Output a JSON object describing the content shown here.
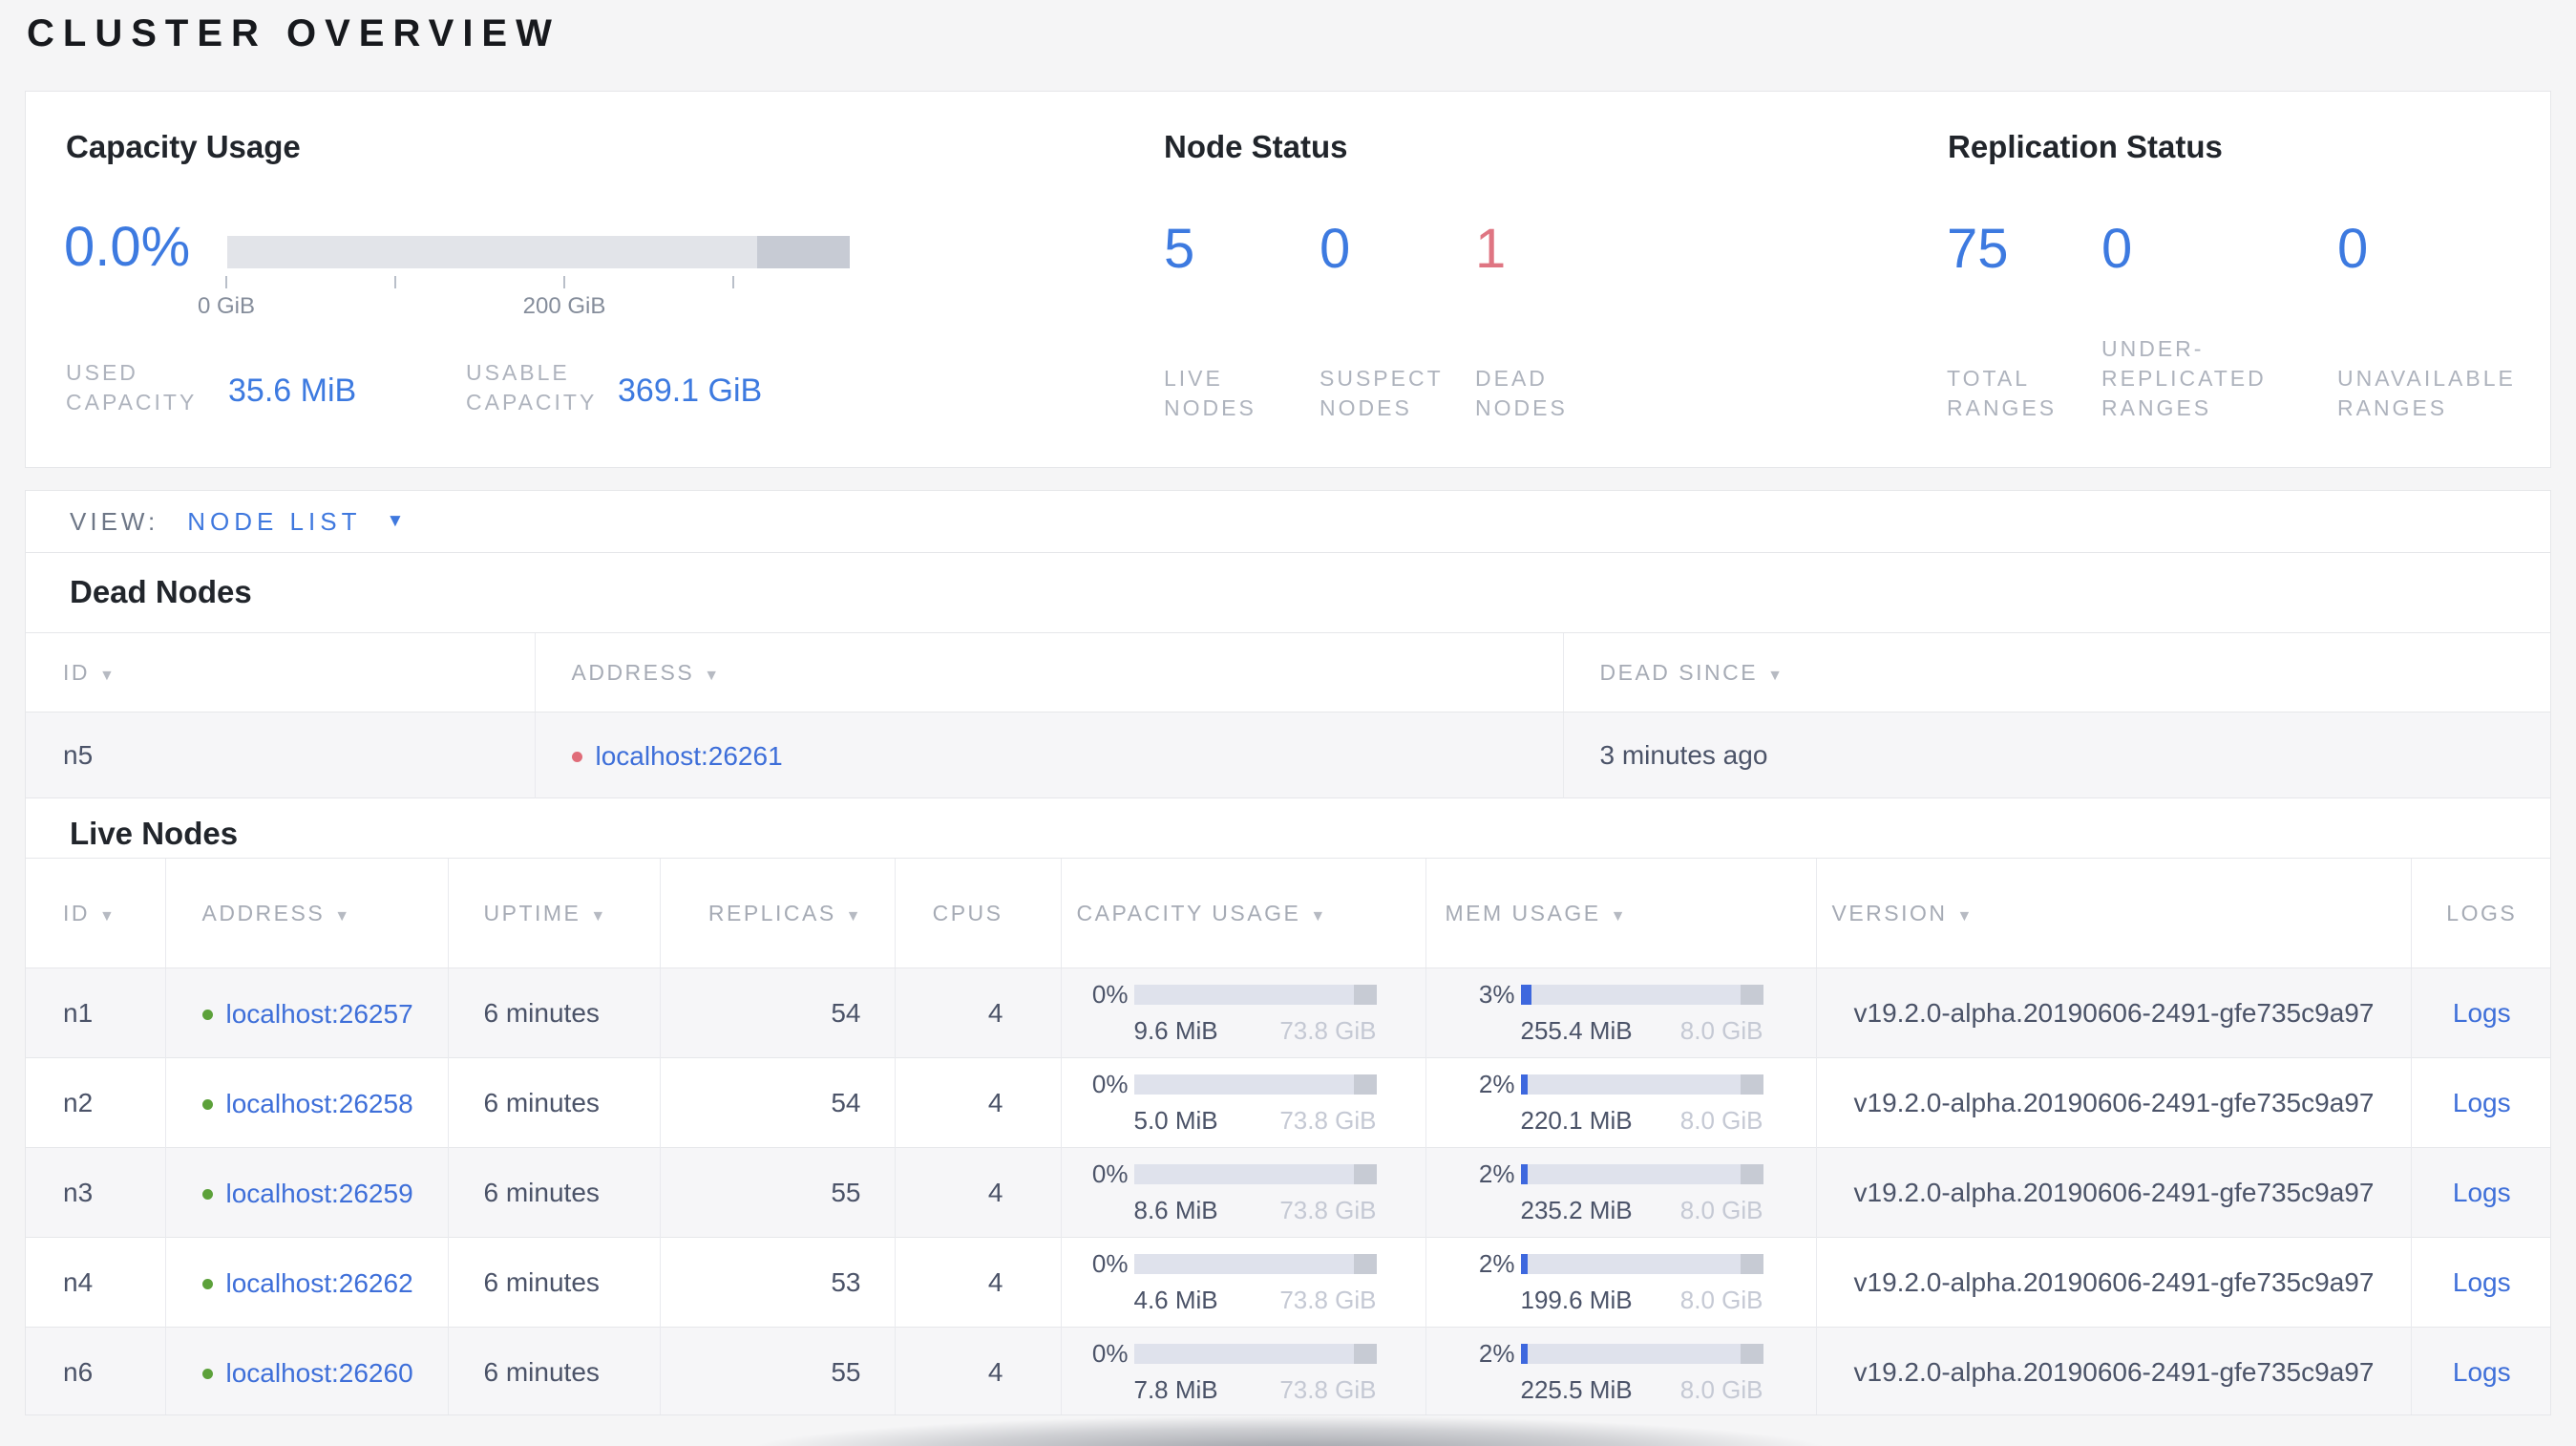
{
  "page": {
    "title": "CLUSTER OVERVIEW"
  },
  "colors": {
    "accent_blue": "#3d7ae0",
    "danger_red": "#df7582",
    "link_blue": "#3e6fd9",
    "live_dot_green": "#5ca13a",
    "dead_dot_red": "#e06c79"
  },
  "summary": {
    "capacity_usage": {
      "title": "Capacity Usage",
      "percent": "0.0%",
      "axis_labels": [
        "0 GiB",
        "",
        "200 GiB",
        ""
      ],
      "used": {
        "label": "USED CAPACITY",
        "value": "35.6 MiB"
      },
      "usable": {
        "label": "USABLE CAPACITY",
        "value": "369.1 GiB"
      }
    },
    "node_status": {
      "title": "Node Status",
      "stats": [
        {
          "value": "5",
          "label": "LIVE NODES"
        },
        {
          "value": "0",
          "label": "SUSPECT NODES"
        },
        {
          "value": "1",
          "label": "DEAD NODES",
          "emphasis": "danger"
        }
      ]
    },
    "replication_status": {
      "title": "Replication Status",
      "stats": [
        {
          "value": "75",
          "label": "TOTAL RANGES"
        },
        {
          "value": "0",
          "label": "UNDER-REPLICATED RANGES"
        },
        {
          "value": "0",
          "label": "UNAVAILABLE RANGES"
        }
      ]
    }
  },
  "view_bar": {
    "label": "VIEW:",
    "selected": "NODE LIST"
  },
  "dead_nodes": {
    "title": "Dead Nodes",
    "columns": [
      {
        "label": "ID",
        "sortable": true
      },
      {
        "label": "ADDRESS",
        "sortable": true
      },
      {
        "label": "DEAD SINCE",
        "sortable": true
      }
    ],
    "rows": [
      {
        "id": "n5",
        "address": "localhost:26261",
        "dead_since": "3 minutes ago"
      }
    ]
  },
  "live_nodes": {
    "title": "Live Nodes",
    "columns": [
      {
        "label": "ID",
        "sortable": true
      },
      {
        "label": "ADDRESS",
        "sortable": true
      },
      {
        "label": "UPTIME",
        "sortable": true
      },
      {
        "label": "REPLICAS",
        "sortable": true
      },
      {
        "label": "CPUS",
        "sortable": false
      },
      {
        "label": "CAPACITY USAGE",
        "sortable": true
      },
      {
        "label": "MEM USAGE",
        "sortable": true
      },
      {
        "label": "VERSION",
        "sortable": true
      },
      {
        "label": "LOGS",
        "sortable": false
      }
    ],
    "rows": [
      {
        "id": "n1",
        "address": "localhost:26257",
        "uptime": "6 minutes",
        "replicas": "54",
        "cpus": "4",
        "capacity": {
          "percent": "0%",
          "used": "9.6 MiB",
          "total": "73.8 GiB"
        },
        "memory": {
          "percent": "3%",
          "used": "255.4 MiB",
          "total": "8.0 GiB"
        },
        "version": "v19.2.0-alpha.20190606-2491-gfe735c9a97",
        "logs_label": "Logs"
      },
      {
        "id": "n2",
        "address": "localhost:26258",
        "uptime": "6 minutes",
        "replicas": "54",
        "cpus": "4",
        "capacity": {
          "percent": "0%",
          "used": "5.0 MiB",
          "total": "73.8 GiB"
        },
        "memory": {
          "percent": "2%",
          "used": "220.1 MiB",
          "total": "8.0 GiB"
        },
        "version": "v19.2.0-alpha.20190606-2491-gfe735c9a97",
        "logs_label": "Logs"
      },
      {
        "id": "n3",
        "address": "localhost:26259",
        "uptime": "6 minutes",
        "replicas": "55",
        "cpus": "4",
        "capacity": {
          "percent": "0%",
          "used": "8.6 MiB",
          "total": "73.8 GiB"
        },
        "memory": {
          "percent": "2%",
          "used": "235.2 MiB",
          "total": "8.0 GiB"
        },
        "version": "v19.2.0-alpha.20190606-2491-gfe735c9a97",
        "logs_label": "Logs"
      },
      {
        "id": "n4",
        "address": "localhost:26262",
        "uptime": "6 minutes",
        "replicas": "53",
        "cpus": "4",
        "capacity": {
          "percent": "0%",
          "used": "4.6 MiB",
          "total": "73.8 GiB"
        },
        "memory": {
          "percent": "2%",
          "used": "199.6 MiB",
          "total": "8.0 GiB"
        },
        "version": "v19.2.0-alpha.20190606-2491-gfe735c9a97",
        "logs_label": "Logs"
      },
      {
        "id": "n6",
        "address": "localhost:26260",
        "uptime": "6 minutes",
        "replicas": "55",
        "cpus": "4",
        "capacity": {
          "percent": "0%",
          "used": "7.8 MiB",
          "total": "73.8 GiB"
        },
        "memory": {
          "percent": "2%",
          "used": "225.5 MiB",
          "total": "8.0 GiB"
        },
        "version": "v19.2.0-alpha.20190606-2491-gfe735c9a97",
        "logs_label": "Logs"
      }
    ]
  }
}
